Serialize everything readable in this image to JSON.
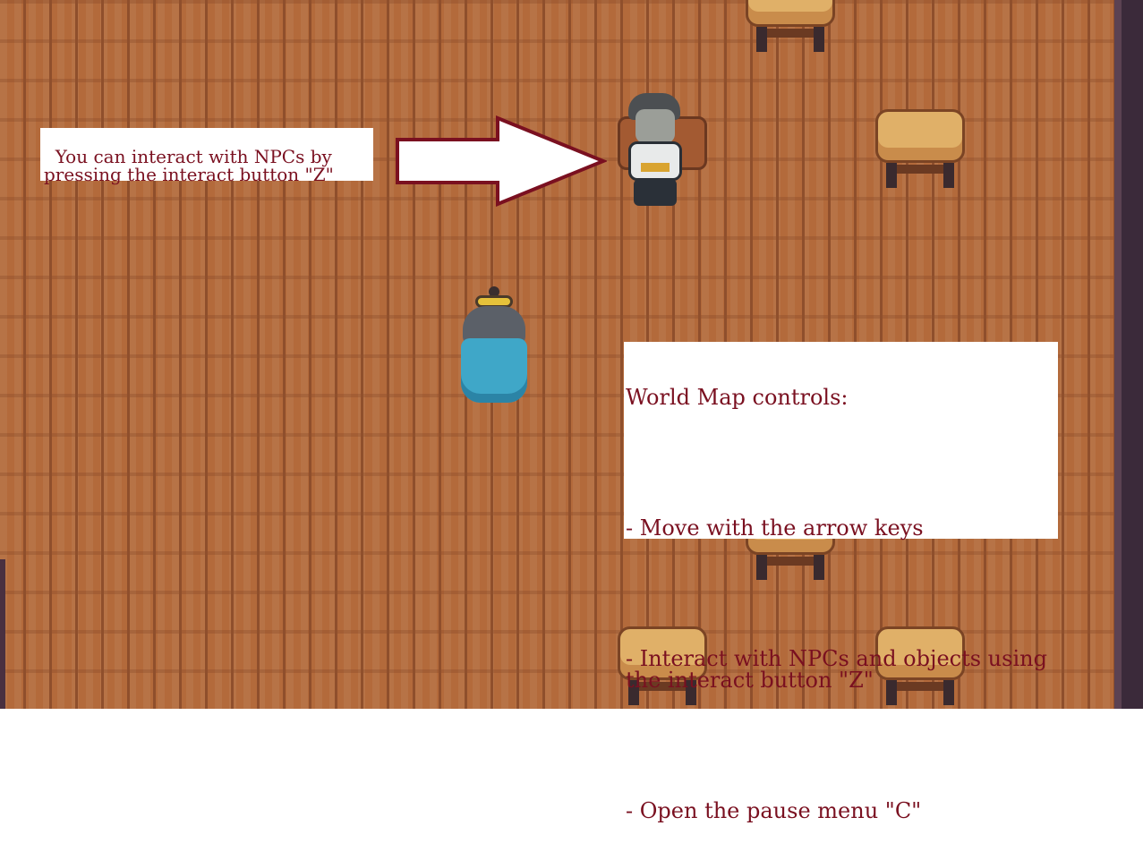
{
  "hints": {
    "npc_hint": "You can interact with NPCs by\npressing the interact button \"Z\"",
    "controls_title": "World Map controls:",
    "controls_move": "- Move with the arrow keys",
    "controls_interact": "- Interact with NPCs and objects using\nthe interact button \"Z\"",
    "controls_pause": "- Open the pause menu \"C\""
  },
  "colors": {
    "hint_text": "#7a1020",
    "arrow_outline": "#7a1020",
    "floor": "#b36a3b"
  }
}
